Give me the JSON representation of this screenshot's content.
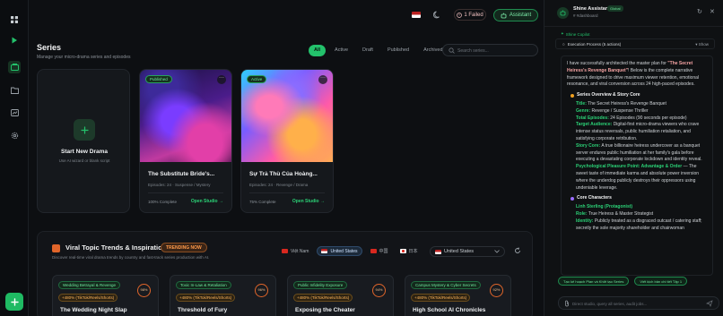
{
  "topbar": {
    "failed_label": "1 Failed",
    "assistant_label": "Assistant"
  },
  "series": {
    "title": "Series",
    "subtitle": "Manage your micro-drama series and episodes",
    "tabs": [
      "All",
      "Active",
      "Draft",
      "Published",
      "Archived"
    ],
    "active_tab": "All",
    "search_placeholder": "Search series..."
  },
  "new_drama": {
    "title": "Start New Drama",
    "subtitle": "Use AI wizard or blank script"
  },
  "cards": [
    {
      "status": "Published",
      "title": "The Substitute Bride's...",
      "meta": "Episodes: 24 · Suspense / Mystery",
      "progress": "100% Complete",
      "action": "Open Studio →"
    },
    {
      "status": "Active",
      "title": "Sự Trả Thù Của Hoàng...",
      "meta": "Episodes: 24 · Revenge / Drama",
      "progress": "75% Complete",
      "action": "Open Studio →"
    }
  ],
  "trends": {
    "title": "Viral Topic Trends & Inspiration",
    "badge": "TRENDING NOW",
    "subtitle": "Discover real-time viral drama trends by country and fast-track series production with AI.",
    "regions": [
      {
        "label": "Việt Nam",
        "selected": false
      },
      {
        "label": "United States",
        "selected": true
      },
      {
        "label": "中国",
        "selected": false
      },
      {
        "label": "日本",
        "selected": false
      }
    ],
    "country_select": "United States",
    "items": [
      {
        "category": "Wedding Betrayal & Revenge",
        "stat": "+480% (TikTok/Reels/Shorts)",
        "score": "98%",
        "name": "The Wedding Night Slap"
      },
      {
        "category": "Toxic In-Law & Retaliation",
        "stat": "+480% (TikTok/Reels/Shorts)",
        "score": "96%",
        "name": "Threshold of Fury"
      },
      {
        "category": "Public Infidelity Exposure",
        "stat": "+480% (TikTok/Reels/Shorts)",
        "score": "94%",
        "name": "Exposing the Cheater"
      },
      {
        "category": "Campus Mystery & Cyber Secrets",
        "stat": "+480% (TikTok/Reels/Shorts)",
        "score": "92%",
        "name": "High School AI Chronicles"
      }
    ]
  },
  "panel": {
    "name": "Shine Assistant",
    "badge": "Global",
    "channel": "# #dashboard",
    "copilot_label": "Shine Copilot",
    "execution": "Execution Process (5 actions)",
    "show_label": "Show",
    "intro_before": "I have successfully architected the master plan for ",
    "intro_highlight": "\"The Secret Heiress's Revenge Banquet\"",
    "intro_after": "! Below is the complete narrative framework designed to drive maximum viewer retention, emotional resonance, and viral conversion across 24 high-paced episodes.",
    "section1": "Series Overview & Story Core",
    "fields": [
      {
        "key": "Title:",
        "value": "The Secret Heiress's Revenge Banquet"
      },
      {
        "key": "Genre:",
        "value": "Revenge / Suspense Thriller"
      },
      {
        "key": "Total Episodes:",
        "value": "24 Episodes (90 seconds per episode)"
      },
      {
        "key": "Target Audience:",
        "value": "Digital-first micro-drama viewers who crave intense status reversals, public humiliation retaliation, and satisfying corporate retribution."
      },
      {
        "key": "Story Core:",
        "value": "A true billionaire heiress undercover as a banquet server endures public humiliation at her family's gala before executing a devastating corporate lockdown and identity reveal."
      },
      {
        "key": "Psychological Pleasure Point: Advantage & Order",
        "value": "— The sweet taste of immediate karma and absolute power inversion where the underdog publicly destroys their oppressors using undeniable leverage."
      }
    ],
    "section2": "Core Characters",
    "char_name": "Linh Sterling (Protagonist)",
    "char_fields": [
      {
        "key": "Role:",
        "value": "True Heiress & Master Strategist"
      },
      {
        "key": "Identity:",
        "value": "Publicly treated as a disgraced outcast / catering staff; secretly the sole majority shareholder and chairwoman"
      }
    ],
    "quick_actions": [
      "Tạo kế hoạch Plan và Khởi tạo Series",
      "Viết kịch bản chi tiết Tập 1"
    ],
    "input_placeholder": "Direct studio, query all series, audit jobs..."
  },
  "colors": {
    "accent": "#23c16b",
    "bg": "#0d0f12",
    "trend_orange": "#e0652a"
  }
}
